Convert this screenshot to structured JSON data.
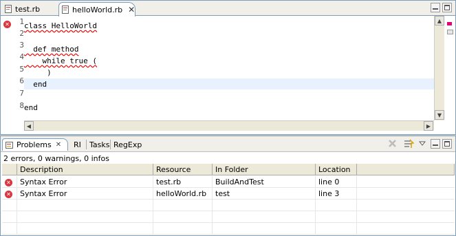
{
  "editor": {
    "tabs": [
      {
        "label": "test.rb",
        "active": false
      },
      {
        "label": "helloWorld.rb",
        "active": true
      }
    ],
    "line_numbers": [
      "1",
      "2",
      "3",
      "4",
      "5",
      "6",
      "7",
      "8"
    ],
    "lines": [
      "class HelloWorld",
      "",
      "  def method",
      "    while true (",
      "     )",
      "  end",
      "",
      "end"
    ],
    "error_line": 1,
    "current_line": 6
  },
  "problems": {
    "tabs": [
      "Problems",
      "RI",
      "Tasks",
      "RegExp"
    ],
    "summary": "2 errors, 0 warnings, 0 infos",
    "columns": [
      "Description",
      "Resource",
      "In Folder",
      "Location"
    ],
    "rows": [
      {
        "description": "Syntax Error",
        "resource": "test.rb",
        "folder": "BuildAndTest",
        "location": "line 0"
      },
      {
        "description": "Syntax Error",
        "resource": "helloWorld.rb",
        "folder": "test",
        "location": "line 3"
      }
    ]
  },
  "colors": {
    "error": "#d9363e",
    "overview_mark": "#e60073",
    "current_line": "#e8f2fe"
  },
  "icons": [
    "file-icon",
    "close-icon",
    "minimize-icon",
    "maximize-icon",
    "error-icon",
    "clear-icon",
    "filter-icon",
    "menu-icon"
  ]
}
